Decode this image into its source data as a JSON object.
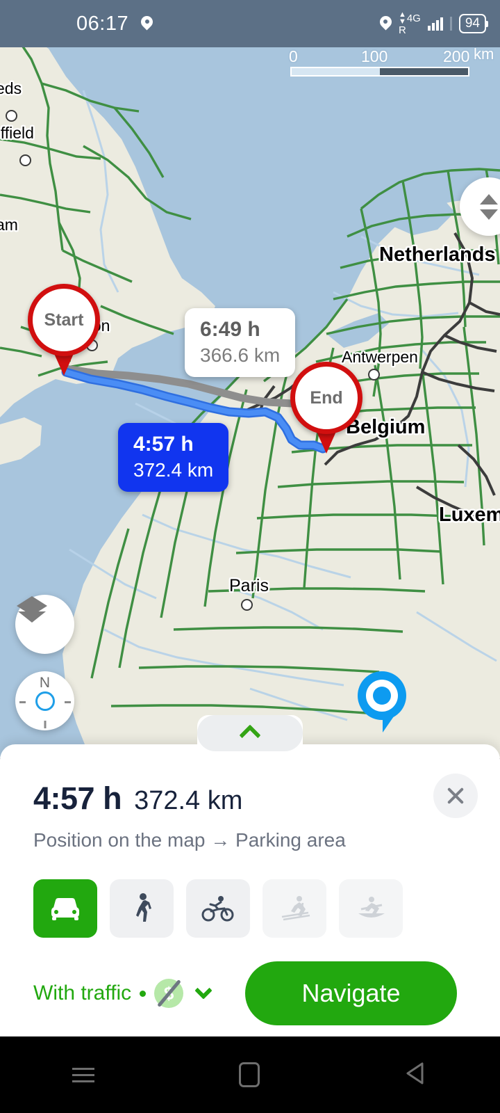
{
  "status_bar": {
    "time": "06:17",
    "location_icon": "location-pin-icon",
    "network_type": "4G",
    "roaming": "R",
    "battery_level": "94"
  },
  "map": {
    "scale": {
      "ticks": [
        "0",
        "100",
        "200"
      ],
      "unit": "km"
    },
    "labels": [
      {
        "text": "eds",
        "type": "city"
      },
      {
        "text": "effield",
        "type": "city"
      },
      {
        "text": "am",
        "type": "city"
      },
      {
        "text": "don",
        "type": "city"
      },
      {
        "text": "Netherlands",
        "type": "country"
      },
      {
        "text": "Antwerpen",
        "type": "city"
      },
      {
        "text": "Belgium",
        "type": "country"
      },
      {
        "text": "Luxemb",
        "type": "country"
      },
      {
        "text": "Paris",
        "type": "city"
      }
    ],
    "start_marker": "Start",
    "end_marker": "End",
    "route_alternate": {
      "time": "6:49 h",
      "distance": "366.6 km"
    },
    "route_primary": {
      "time": "4:57 h",
      "distance": "372.4 km"
    },
    "controls": {
      "tilt": "tilt-control",
      "layers": "layers-icon",
      "compass_north": "N",
      "gps": "current-location-marker"
    }
  },
  "sheet": {
    "expand_handle": "chevron-up-icon",
    "eta": "4:57 h",
    "distance": "372.4 km",
    "route_summary": "Position on the map → Parking area",
    "close_label": "close-icon",
    "modes": [
      {
        "name": "car",
        "icon": "car-icon",
        "state": "active"
      },
      {
        "name": "walk",
        "icon": "pedestrian-icon",
        "state": "enabled"
      },
      {
        "name": "bicycle",
        "icon": "bicycle-icon",
        "state": "enabled"
      },
      {
        "name": "ski",
        "icon": "skier-icon",
        "state": "disabled"
      },
      {
        "name": "boat",
        "icon": "canoe-icon",
        "state": "disabled"
      }
    ],
    "traffic_label": "With traffic",
    "separator": "•",
    "toll_icon": "no-toll-icon",
    "options_chevron": "chevron-down-icon",
    "navigate_label": "Navigate"
  },
  "android_nav": {
    "recents": "recents-icon",
    "home": "home-icon",
    "back": "back-icon"
  },
  "colors": {
    "status_bar": "#5c7086",
    "accent_green": "#22a80f",
    "route_blue": "#1135ef",
    "marker_red": "#d10f0f",
    "land": "#ecebe0",
    "water": "#a8c5dd",
    "road_green": "#3f8f43"
  }
}
